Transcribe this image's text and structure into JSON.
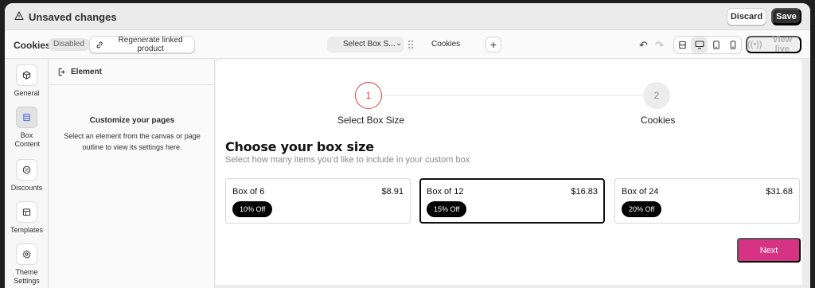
{
  "colors": {
    "accent_pink": "#d63384",
    "step_active": "#e23b3b",
    "dark": "#303030"
  },
  "unsaved_bar": {
    "icon": "warning-icon",
    "text": "Unsaved changes",
    "discard_label": "Discard",
    "save_label": "Save"
  },
  "toolbar": {
    "title": "Cookies",
    "status_badge": "Disabled",
    "regenerate_label": "Regenerate linked product",
    "page_select": "Select Box S...",
    "page_name": "Cookies",
    "add_icon": "plus-icon",
    "view_live_label": "View live"
  },
  "leftnav": {
    "items": [
      {
        "label": "General",
        "icon": "cube-icon"
      },
      {
        "label": "Box Content",
        "icon": "list-icon"
      },
      {
        "label": "Discounts",
        "icon": "discount-icon"
      },
      {
        "label": "Templates",
        "icon": "template-icon"
      },
      {
        "label": "Theme Settings",
        "icon": "gear-icon"
      }
    ]
  },
  "panel": {
    "title": "Element",
    "empty_title": "Customize your pages",
    "empty_text": "Select an element from the canvas or page outline to view its settings here."
  },
  "canvas": {
    "steps": [
      {
        "number": "1",
        "label": "Select Box Size"
      },
      {
        "number": "2",
        "label": "Cookies"
      }
    ],
    "heading": "Choose your box size",
    "subheading": "Select how many items you'd like to include in your custom box",
    "options": [
      {
        "name": "Box of 6",
        "price": "$8.91",
        "badge": "10% Off"
      },
      {
        "name": "Box of 12",
        "price": "$16.83",
        "badge": "15% Off"
      },
      {
        "name": "Box of 24",
        "price": "$31.68",
        "badge": "20% Off"
      }
    ],
    "next_label": "Next"
  }
}
